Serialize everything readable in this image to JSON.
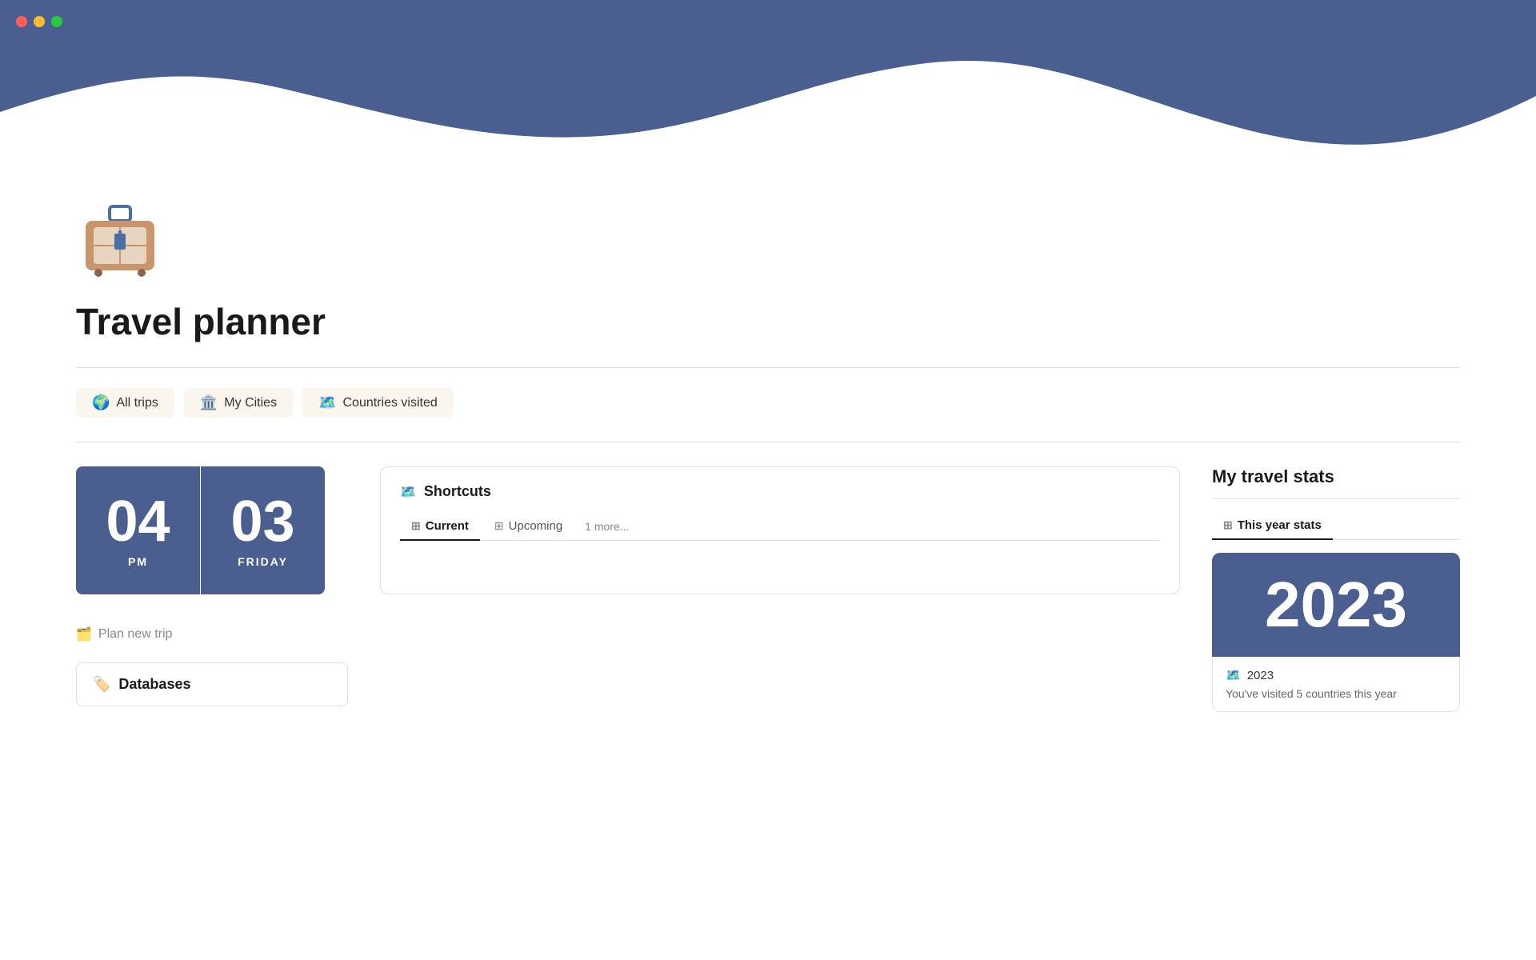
{
  "trafficLights": {
    "red": "red-light",
    "yellow": "yellow-light",
    "green": "green-light"
  },
  "header": {
    "waveColor": "#4a5f8f"
  },
  "page": {
    "title": "Travel planner",
    "icon": "🧳"
  },
  "navTabs": [
    {
      "id": "all-trips",
      "emoji": "🌍",
      "label": "All trips"
    },
    {
      "id": "my-cities",
      "emoji": "🏛️",
      "label": "My Cities"
    },
    {
      "id": "countries-visited",
      "emoji": "🗺️",
      "label": "Countries visited"
    }
  ],
  "clock": {
    "hour": "04",
    "minute": "03",
    "period": "PM",
    "dayLabel": "FRIDAY"
  },
  "planTrip": {
    "label": "Plan new trip",
    "icon": "🗂️"
  },
  "databases": {
    "label": "Databases",
    "icon": "🏷️"
  },
  "shortcuts": {
    "title": "Shortcuts",
    "emoji": "🗺️",
    "tabs": [
      {
        "id": "current",
        "label": "Current",
        "active": true
      },
      {
        "id": "upcoming",
        "label": "Upcoming",
        "active": false
      },
      {
        "id": "more",
        "label": "1 more...",
        "active": false
      }
    ]
  },
  "travelStats": {
    "title": "My travel stats",
    "tabs": [
      {
        "id": "this-year",
        "label": "This year stats",
        "active": true
      }
    ],
    "yearCard": {
      "year": "2023",
      "yearLabel": "2023",
      "description": "You've visited 5 countries this year"
    }
  }
}
